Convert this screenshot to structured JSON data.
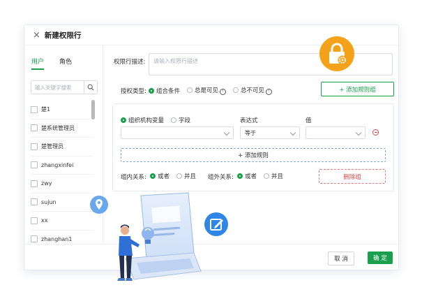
{
  "dialog": {
    "title": "新建权限行",
    "close_label": "×"
  },
  "left_panel": {
    "tabs": [
      {
        "label": "用户",
        "active": true
      },
      {
        "label": "角色",
        "active": false
      }
    ],
    "search": {
      "placeholder": "输入关键字搜索",
      "value": ""
    },
    "users": [
      "楚1",
      "楚系统管理员",
      "楚管理员",
      "zhangxinfei",
      "zwy",
      "sujun",
      "xx",
      "zhanghan1"
    ]
  },
  "form": {
    "desc_label": "权限行描述:",
    "desc_placeholder": "请输入权限行描述",
    "auth_type_label": "授权类型:",
    "auth_types": [
      {
        "label": "组合条件",
        "selected": true,
        "info": false
      },
      {
        "label": "总是可见",
        "selected": false,
        "info": true
      },
      {
        "label": "总不可见",
        "selected": false,
        "info": true
      }
    ],
    "add_group_label": "+ 添加规则组",
    "rule": {
      "field_types": [
        {
          "label": "组织机构变量",
          "selected": true
        },
        {
          "label": "字段",
          "selected": false
        }
      ],
      "expression_label": "表达式",
      "value_label": "值",
      "field_value": "",
      "expression_value": "等于",
      "value_value": ""
    },
    "add_rule_label": "+ 添加规则",
    "inner_relation_label": "组内关系:",
    "inner_relations": [
      {
        "label": "或者",
        "selected": true
      },
      {
        "label": "并且",
        "selected": false
      }
    ],
    "outer_relation_label": "组外关系:",
    "outer_relations": [
      {
        "label": "或者",
        "selected": true
      },
      {
        "label": "并且",
        "selected": false
      }
    ],
    "delete_group_label": "删除组"
  },
  "footer": {
    "cancel_label": "取 消",
    "confirm_label": "确 定"
  },
  "colors": {
    "primary_green": "#1aa04d",
    "danger_red": "#e24a4a",
    "lock_orange": "#f5a21b",
    "edit_blue": "#2f86e6",
    "pin_blue": "#6aa8ee"
  },
  "decorations": {
    "lock_badge_icon": "lock-gear-icon",
    "edit_badge_icon": "edit-icon",
    "pin_badge_icon": "location-pin-icon",
    "illustration": "person-with-laptop-illustration"
  }
}
